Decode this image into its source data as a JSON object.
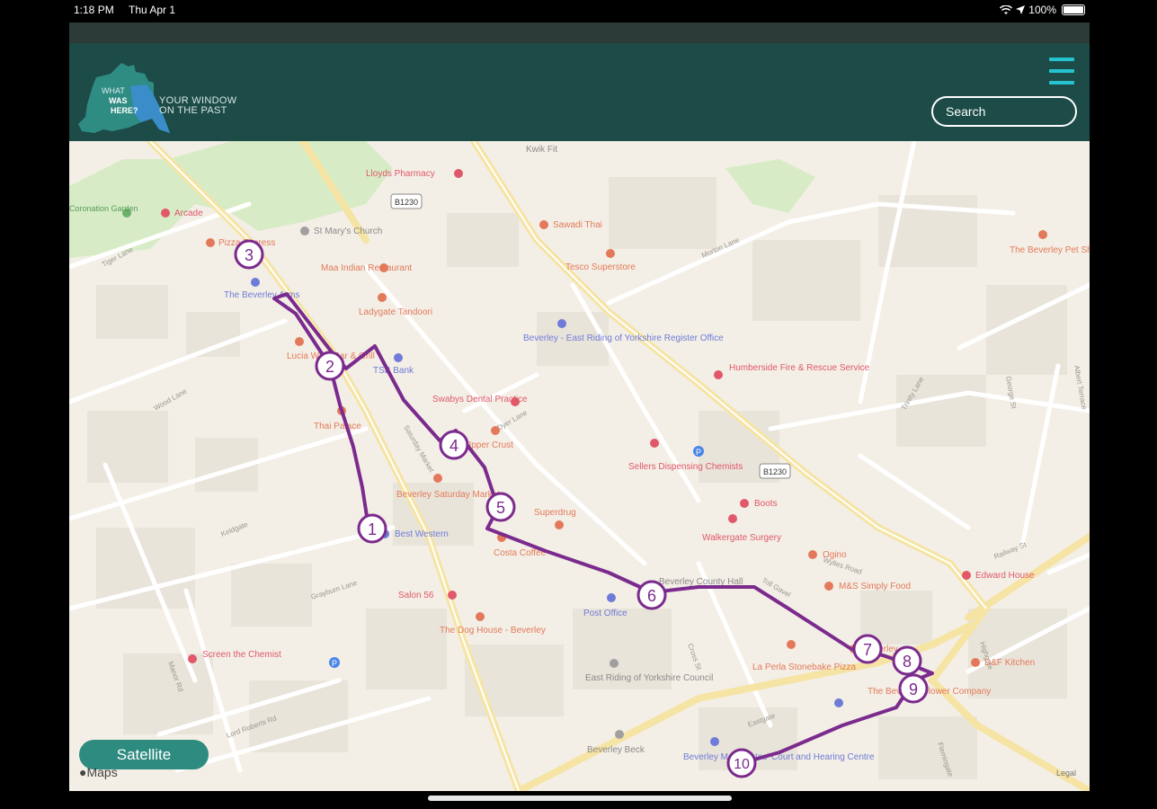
{
  "status_bar": {
    "time": "1:18 PM",
    "date": "Thu Apr 1",
    "battery": "100%"
  },
  "header": {
    "logo_text": [
      "WHAT",
      "WAS",
      "HERE?"
    ],
    "tagline_line1": "YOUR WINDOW",
    "tagline_line2": "ON THE PAST",
    "search_placeholder": "Search"
  },
  "map": {
    "satellite_label": "Satellite",
    "brand": "Maps",
    "legal": "Legal",
    "route_stops": [
      "1",
      "2",
      "3",
      "4",
      "5",
      "6",
      "7",
      "8",
      "9",
      "10"
    ],
    "road_badges": [
      "B1230",
      "B1230"
    ],
    "places": [
      {
        "name": "Lloyds Pharmacy",
        "kind": "red"
      },
      {
        "name": "Kwik Fit",
        "kind": "gray"
      },
      {
        "name": "Coronation Garden",
        "kind": "green"
      },
      {
        "name": "Arcade",
        "kind": "red"
      },
      {
        "name": "St Mary's Church",
        "kind": "gray"
      },
      {
        "name": "Pizza Express",
        "kind": "orange"
      },
      {
        "name": "Maa Indian Restaurant",
        "kind": "orange"
      },
      {
        "name": "Sawadi Thai",
        "kind": "orange"
      },
      {
        "name": "Tesco Superstore",
        "kind": "orange"
      },
      {
        "name": "The Beverley Pet Shop",
        "kind": "orange"
      },
      {
        "name": "The Beverley Arms",
        "kind": "blue"
      },
      {
        "name": "Ladygate Tandoori",
        "kind": "orange"
      },
      {
        "name": "Beverley - East Riding of Yorkshire Register Office",
        "kind": "blue"
      },
      {
        "name": "Lucia Wine Bar & Grill",
        "kind": "orange"
      },
      {
        "name": "TSB Bank",
        "kind": "blue"
      },
      {
        "name": "Humberside Fire & Rescue Service",
        "kind": "red"
      },
      {
        "name": "Swabys Dental Practice",
        "kind": "red"
      },
      {
        "name": "Thai Palace",
        "kind": "orange"
      },
      {
        "name": "Upper Crust",
        "kind": "orange"
      },
      {
        "name": "Sellers Dispensing Chemists",
        "kind": "red"
      },
      {
        "name": "Beverley Saturday Market",
        "kind": "orange"
      },
      {
        "name": "Superdrug",
        "kind": "orange"
      },
      {
        "name": "Boots",
        "kind": "red"
      },
      {
        "name": "Walkergate Surgery",
        "kind": "red"
      },
      {
        "name": "Best Western",
        "kind": "blue"
      },
      {
        "name": "Costa Coffee",
        "kind": "orange"
      },
      {
        "name": "Ogino",
        "kind": "orange"
      },
      {
        "name": "Edward House",
        "kind": "red"
      },
      {
        "name": "Beverley County Hall",
        "kind": "gray"
      },
      {
        "name": "M&S Simply Food",
        "kind": "orange"
      },
      {
        "name": "Salon 56",
        "kind": "red"
      },
      {
        "name": "Post Office",
        "kind": "blue"
      },
      {
        "name": "The Dog House - Beverley",
        "kind": "orange"
      },
      {
        "name": "La Perla Stonebake Pizza",
        "kind": "orange"
      },
      {
        "name": "D&F Kitchen",
        "kind": "orange"
      },
      {
        "name": "Beverley",
        "kind": "orange"
      },
      {
        "name": "Screen the Chemist",
        "kind": "red"
      },
      {
        "name": "East Riding of Yorkshire Council",
        "kind": "gray"
      },
      {
        "name": "The Beverley Flower Company",
        "kind": "orange"
      },
      {
        "name": "Beverley Beck",
        "kind": "gray"
      },
      {
        "name": "Beverley Magistrates' Court and Hearing Centre",
        "kind": "blue"
      }
    ],
    "streets": [
      "Tiger Lane",
      "Dyer Lane",
      "Saturday Market",
      "Morton Lane",
      "Railway St",
      "Wood Lane",
      "Toll Gavel",
      "Cross St",
      "Lord Roberts Rd",
      "Grayburn Lane",
      "Keldgate",
      "Manor Rd",
      "Flemingate",
      "Trinity Lane",
      "George St",
      "Albert Terrace",
      "Eastgate",
      "Wylies Road",
      "Highgate"
    ]
  },
  "colors": {
    "header_bg": "#1c4b48",
    "accent": "#26c2cf",
    "route": "#7b2a8d",
    "satellite_button": "#2e8b80"
  }
}
